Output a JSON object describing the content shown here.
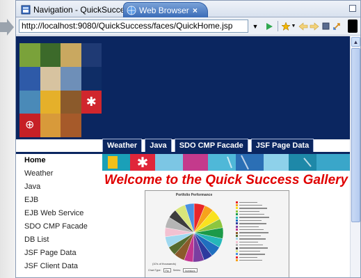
{
  "tabs": [
    {
      "label": "Navigation - QuickSuccess",
      "active": false
    },
    {
      "label": "Web Browser",
      "active": true
    }
  ],
  "tab_close_glyph": "×",
  "address_bar": {
    "url": "http://localhost:9080/QuickSuccess/faces/QuickHome.jsp"
  },
  "toolbar_icons": [
    "go-icon",
    "bookmark-icon",
    "back-icon",
    "forward-icon",
    "stop-icon",
    "refresh-icon"
  ],
  "nav_tabs": [
    "Weather",
    "Java",
    "SDO CMP Facade",
    "JSF Page Data"
  ],
  "left_nav": [
    {
      "label": "Home",
      "active": true
    },
    {
      "label": "Weather"
    },
    {
      "label": "Java"
    },
    {
      "label": "EJB"
    },
    {
      "label": "EJB Web Service"
    },
    {
      "label": "SDO CMP Facade"
    },
    {
      "label": "DB List"
    },
    {
      "label": "JSF Page Data"
    },
    {
      "label": "JSF Client Data"
    }
  ],
  "welcome": "Welcome to the Quick Success Gallery",
  "chart": {
    "title": "Portfolio Performance",
    "footer": "(10's of thousands)",
    "control_chart_type_label": "Chart Type:",
    "control_chart_type_value": "Pie",
    "control_series_label": "Series:",
    "control_series_value": "Investors"
  },
  "chart_data": {
    "type": "pie",
    "title": "Portfolio Performance",
    "xlabel": "(10's of thousands)",
    "series": [
      {
        "color": "#e8262a",
        "value": 6
      },
      {
        "color": "#f7a21b",
        "value": 5
      },
      {
        "color": "#f9e21f",
        "value": 6
      },
      {
        "color": "#8dc63f",
        "value": 5
      },
      {
        "color": "#1c9a48",
        "value": 6
      },
      {
        "color": "#25b7b9",
        "value": 5
      },
      {
        "color": "#1f6fbf",
        "value": 6
      },
      {
        "color": "#2d3a9e",
        "value": 5
      },
      {
        "color": "#7a3ea0",
        "value": 6
      },
      {
        "color": "#c2358f",
        "value": 5
      },
      {
        "color": "#8b5a2b",
        "value": 6
      },
      {
        "color": "#556b2f",
        "value": 5
      },
      {
        "color": "#9fd8ef",
        "value": 6
      },
      {
        "color": "#f2c1d1",
        "value": 5
      },
      {
        "color": "#b5b5b5",
        "value": 6
      },
      {
        "color": "#3d3d3d",
        "value": 5
      },
      {
        "color": "#d9e67b",
        "value": 6
      },
      {
        "color": "#4a90e2",
        "value": 5
      }
    ],
    "legend_entries": 20
  },
  "colors": {
    "banner_blue": "#0b2660",
    "welcome_red": "#e00000",
    "active_tab": "#3a6cb8"
  }
}
